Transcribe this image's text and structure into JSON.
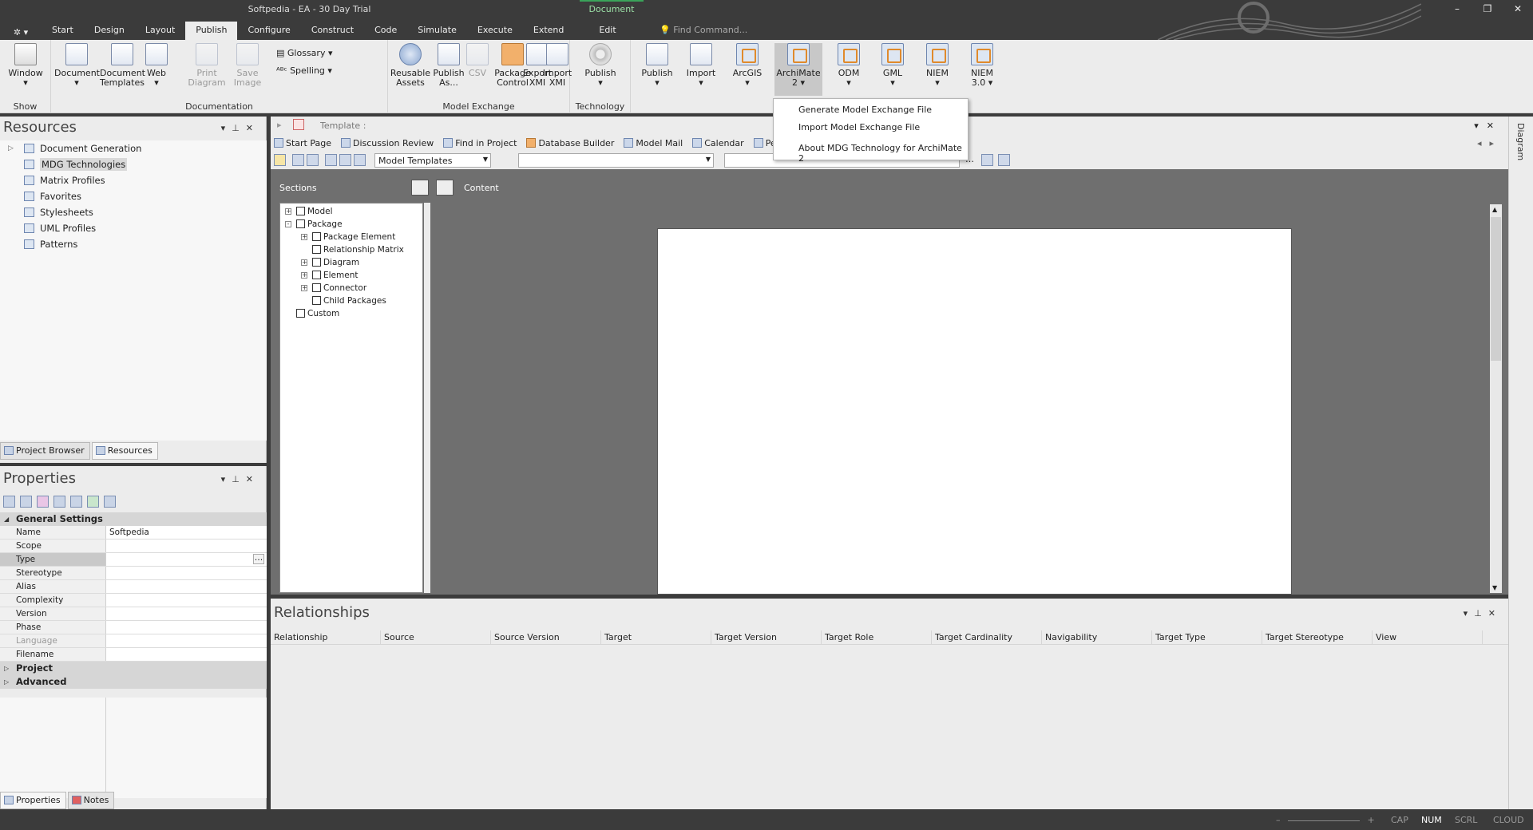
{
  "window": {
    "title": "Softpedia - EA - 30 Day Trial",
    "context_tab": "Document",
    "controls": [
      "–",
      "❐",
      "✕"
    ]
  },
  "menu": {
    "tabs": [
      "Start",
      "Design",
      "Layout",
      "Publish",
      "Configure",
      "Construct",
      "Code",
      "Simulate",
      "Execute",
      "Extend",
      "Edit"
    ],
    "active": "Publish",
    "find_placeholder": "Find Command..."
  },
  "ribbon": {
    "show": {
      "label": "Show",
      "window": "Window"
    },
    "documentation": {
      "label": "Documentation",
      "document": "Document",
      "document_templates": "Document\nTemplates",
      "web": "Web",
      "print_diagram": "Print\nDiagram",
      "save_image": "Save\nImage",
      "glossary": "Glossary",
      "spelling": "Spelling"
    },
    "model_exchange": {
      "label": "Model Exchange",
      "reusable_assets": "Reusable\nAssets",
      "publish_as": "Publish\nAs...",
      "csv": "CSV",
      "package_control": "Package\nControl",
      "export_xmi": "Export\nXMI",
      "import_xmi": "Import\nXMI"
    },
    "technology": {
      "label": "Technology",
      "publish": "Publish"
    },
    "mdg": {
      "publish": "Publish",
      "import": "Import",
      "arcgis": "ArcGIS",
      "archimate2": "ArchiMate\n2",
      "odm": "ODM",
      "gml": "GML",
      "niem": "NIEM",
      "niem3": "NIEM\n3.0"
    }
  },
  "dropdown": {
    "items": [
      "Generate Model Exchange File",
      "Import Model Exchange File",
      "About MDG Technology for ArchiMate 2"
    ]
  },
  "resources": {
    "title": "Resources",
    "items": [
      "Document Generation",
      "MDG Technologies",
      "Matrix Profiles",
      "Favorites",
      "Stylesheets",
      "UML Profiles",
      "Patterns"
    ],
    "selected": "MDG Technologies",
    "tabs": [
      "Project Browser",
      "Resources"
    ]
  },
  "properties": {
    "title": "Properties",
    "general_header": "General Settings",
    "rows": [
      {
        "k": "Name",
        "v": "Softpedia"
      },
      {
        "k": "Scope",
        "v": ""
      },
      {
        "k": "Type",
        "v": ""
      },
      {
        "k": "Stereotype",
        "v": ""
      },
      {
        "k": "Alias",
        "v": ""
      },
      {
        "k": "Complexity",
        "v": ""
      },
      {
        "k": "Version",
        "v": ""
      },
      {
        "k": "Phase",
        "v": ""
      },
      {
        "k": "Language",
        "v": ""
      },
      {
        "k": "Filename",
        "v": ""
      }
    ],
    "project_header": "Project",
    "advanced_header": "Advanced",
    "tabs": [
      "Properties",
      "Notes"
    ]
  },
  "document": {
    "template_label": "Template :",
    "links": [
      "Start Page",
      "Discussion Review",
      "Find in Project",
      "Database Builder",
      "Model Mail",
      "Calendar",
      "Pers"
    ],
    "template_select": "Model Templates",
    "sections_label": "Sections",
    "content_label": "Content",
    "tree": [
      {
        "label": "Model",
        "level": 0,
        "exp": "+"
      },
      {
        "label": "Package",
        "level": 0,
        "exp": "-"
      },
      {
        "label": "Package Element",
        "level": 1,
        "exp": "+"
      },
      {
        "label": "Relationship Matrix",
        "level": 1,
        "exp": ""
      },
      {
        "label": "Diagram",
        "level": 1,
        "exp": "+"
      },
      {
        "label": "Element",
        "level": 1,
        "exp": "+"
      },
      {
        "label": "Connector",
        "level": 1,
        "exp": "+"
      },
      {
        "label": "Child Packages",
        "level": 1,
        "exp": ""
      },
      {
        "label": "Custom",
        "level": 0,
        "exp": ""
      }
    ]
  },
  "side_strip": {
    "label": "Diagram"
  },
  "relationships": {
    "title": "Relationships",
    "columns": [
      "Relationship",
      "Source",
      "Source Version",
      "Target",
      "Target Version",
      "Target Role",
      "Target Cardinality",
      "Navigability",
      "Target Type",
      "Target Stereotype",
      "View"
    ]
  },
  "status": {
    "zoom_minus": "–",
    "zoom_plus": "+",
    "indicators": [
      {
        "label": "CAP",
        "on": false
      },
      {
        "label": "NUM",
        "on": true
      },
      {
        "label": "SCRL",
        "on": false
      },
      {
        "label": "CLOUD",
        "on": false
      }
    ]
  }
}
